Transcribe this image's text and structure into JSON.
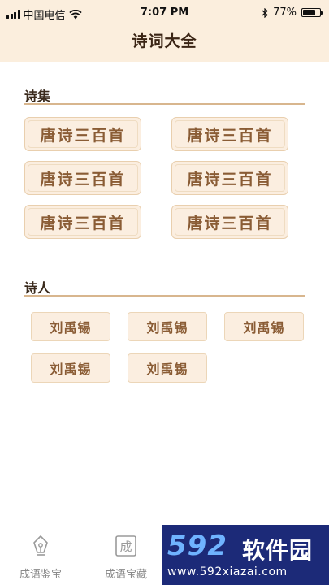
{
  "status_bar": {
    "carrier": "中国电信",
    "time": "7:07 PM",
    "battery": "77%",
    "battery_level": 0.77
  },
  "header": {
    "title": "诗词大全"
  },
  "collections": {
    "title": "诗集",
    "items": [
      "唐诗三百首",
      "唐诗三百首",
      "唐诗三百首",
      "唐诗三百首",
      "唐诗三百首",
      "唐诗三百首"
    ]
  },
  "poets": {
    "title": "诗人",
    "items": [
      "刘禹锡",
      "刘禹锡",
      "刘禹锡",
      "刘禹锡",
      "刘禹锡"
    ]
  },
  "tabbar": {
    "tabs": [
      {
        "label": "成语鉴宝",
        "icon": "pen-nib-icon"
      },
      {
        "label": "成语宝藏",
        "icon": "stamp-icon",
        "glyph": "成"
      }
    ]
  },
  "watermark": {
    "number": "592",
    "name": "软件园",
    "url": "www.592xiazai.com"
  },
  "colors": {
    "header_bg": "#fbeedd",
    "button_bg": "#fbeee0",
    "button_text": "#8a5c35",
    "divider": "#d8b68e"
  }
}
